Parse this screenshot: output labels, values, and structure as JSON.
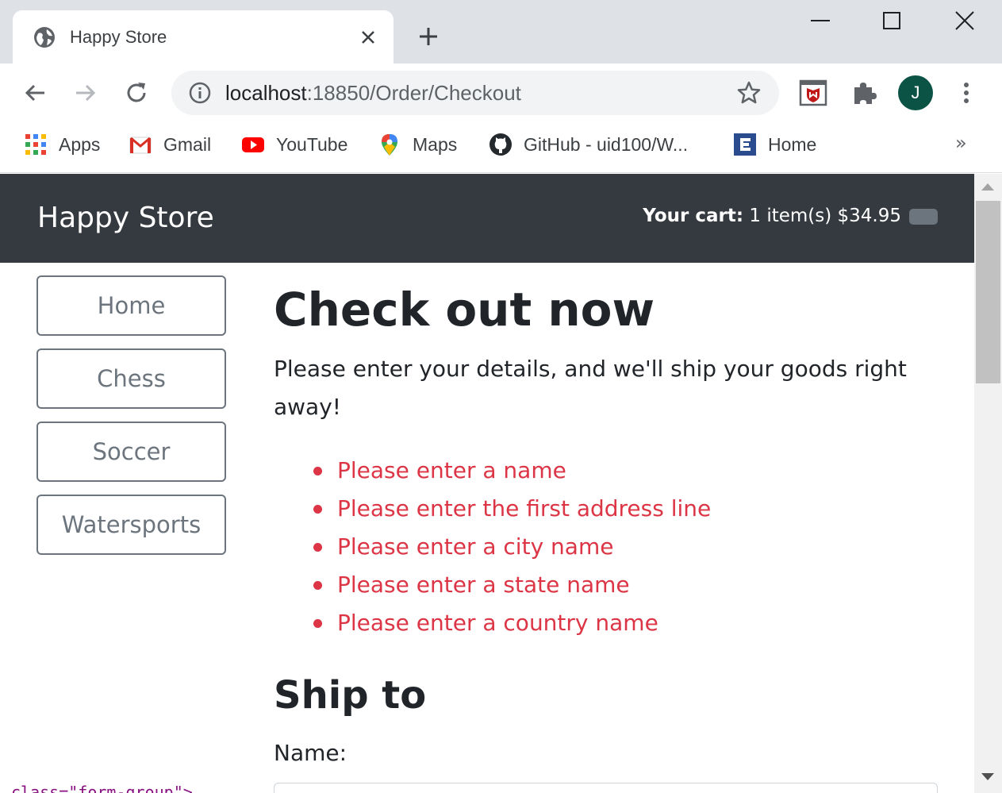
{
  "browser": {
    "tab_title": "Happy Store",
    "url_host": "localhost",
    "url_path": ":18850/Order/Checkout",
    "profile_initial": "J",
    "bookmarks": [
      {
        "label": "Apps",
        "icon": "apps-grid-icon"
      },
      {
        "label": "Gmail",
        "icon": "gmail-icon"
      },
      {
        "label": "YouTube",
        "icon": "youtube-icon"
      },
      {
        "label": "Maps",
        "icon": "maps-icon"
      },
      {
        "label": "GitHub - uid100/W...",
        "icon": "github-icon"
      },
      {
        "label": "Home",
        "icon": "home-e-icon"
      }
    ],
    "bookmarks_overflow": "»"
  },
  "store": {
    "brand": "Happy Store",
    "cart_label": "Your cart:",
    "cart_summary": " 1 item(s) $34.95"
  },
  "categories": [
    "Home",
    "Chess",
    "Soccer",
    "Watersports"
  ],
  "checkout": {
    "title": "Check out now",
    "lead": "Please enter your details, and we'll ship your goods right away!",
    "errors": [
      "Please enter a name",
      "Please enter the first address line",
      "Please enter a city name",
      "Please enter a state name",
      "Please enter a country name"
    ],
    "ship_heading": "Ship to",
    "name_label": "Name:"
  },
  "devtools_fragment": "class=\"form-group\">",
  "colors": {
    "navbar": "#343a40",
    "error": "#dc3545",
    "outline_secondary": "#6c757d",
    "avatar": "#0b5345"
  }
}
